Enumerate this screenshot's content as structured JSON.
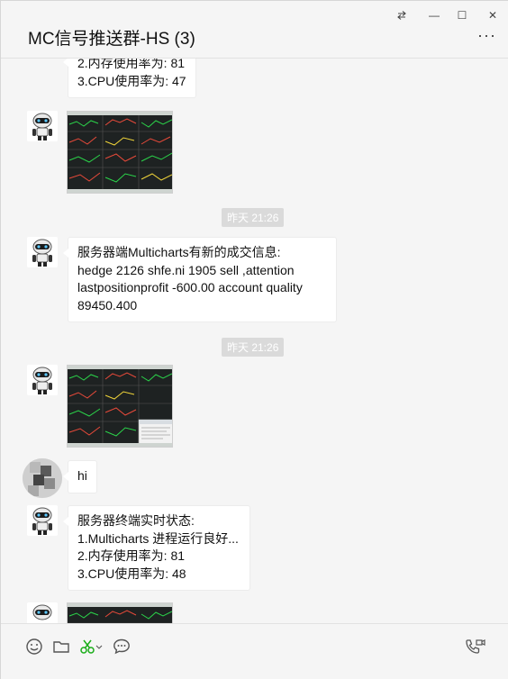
{
  "window": {
    "title": "MC信号推送群-HS (3)",
    "controls": {
      "pin": "swap-horizontal-icon",
      "minimize": "—",
      "maximize": "☐",
      "close": "✕"
    },
    "more_label": "···"
  },
  "messages": {
    "m1_lines": [
      "2.内存使用率为: 81",
      "3.CPU使用率为: 47"
    ],
    "time1": "昨天 21:26",
    "m3_lines": [
      "服务器端Multicharts有新的成交信息:",
      "hedge  2126  shfe.ni 1905 sell ,attention",
      "lastpositionprofit -600.00 account quality",
      "89450.400"
    ],
    "time2": "昨天 21:26",
    "m5_text": "hi",
    "m6_lines": [
      "服务器终端实时状态:",
      "1.Multicharts 进程运行良好...",
      "2.内存使用率为: 81",
      "3.CPU使用率为: 48"
    ]
  },
  "toolbar": {
    "emoji": "smiley-icon",
    "file": "folder-icon",
    "screenshot": "scissors-icon",
    "chat": "chat-bubble-icon",
    "call": "phone-video-icon"
  },
  "colors": {
    "screenshot_green": "#1aad19",
    "bubble_bg": "#ffffff",
    "chip_bg": "#dadada"
  }
}
